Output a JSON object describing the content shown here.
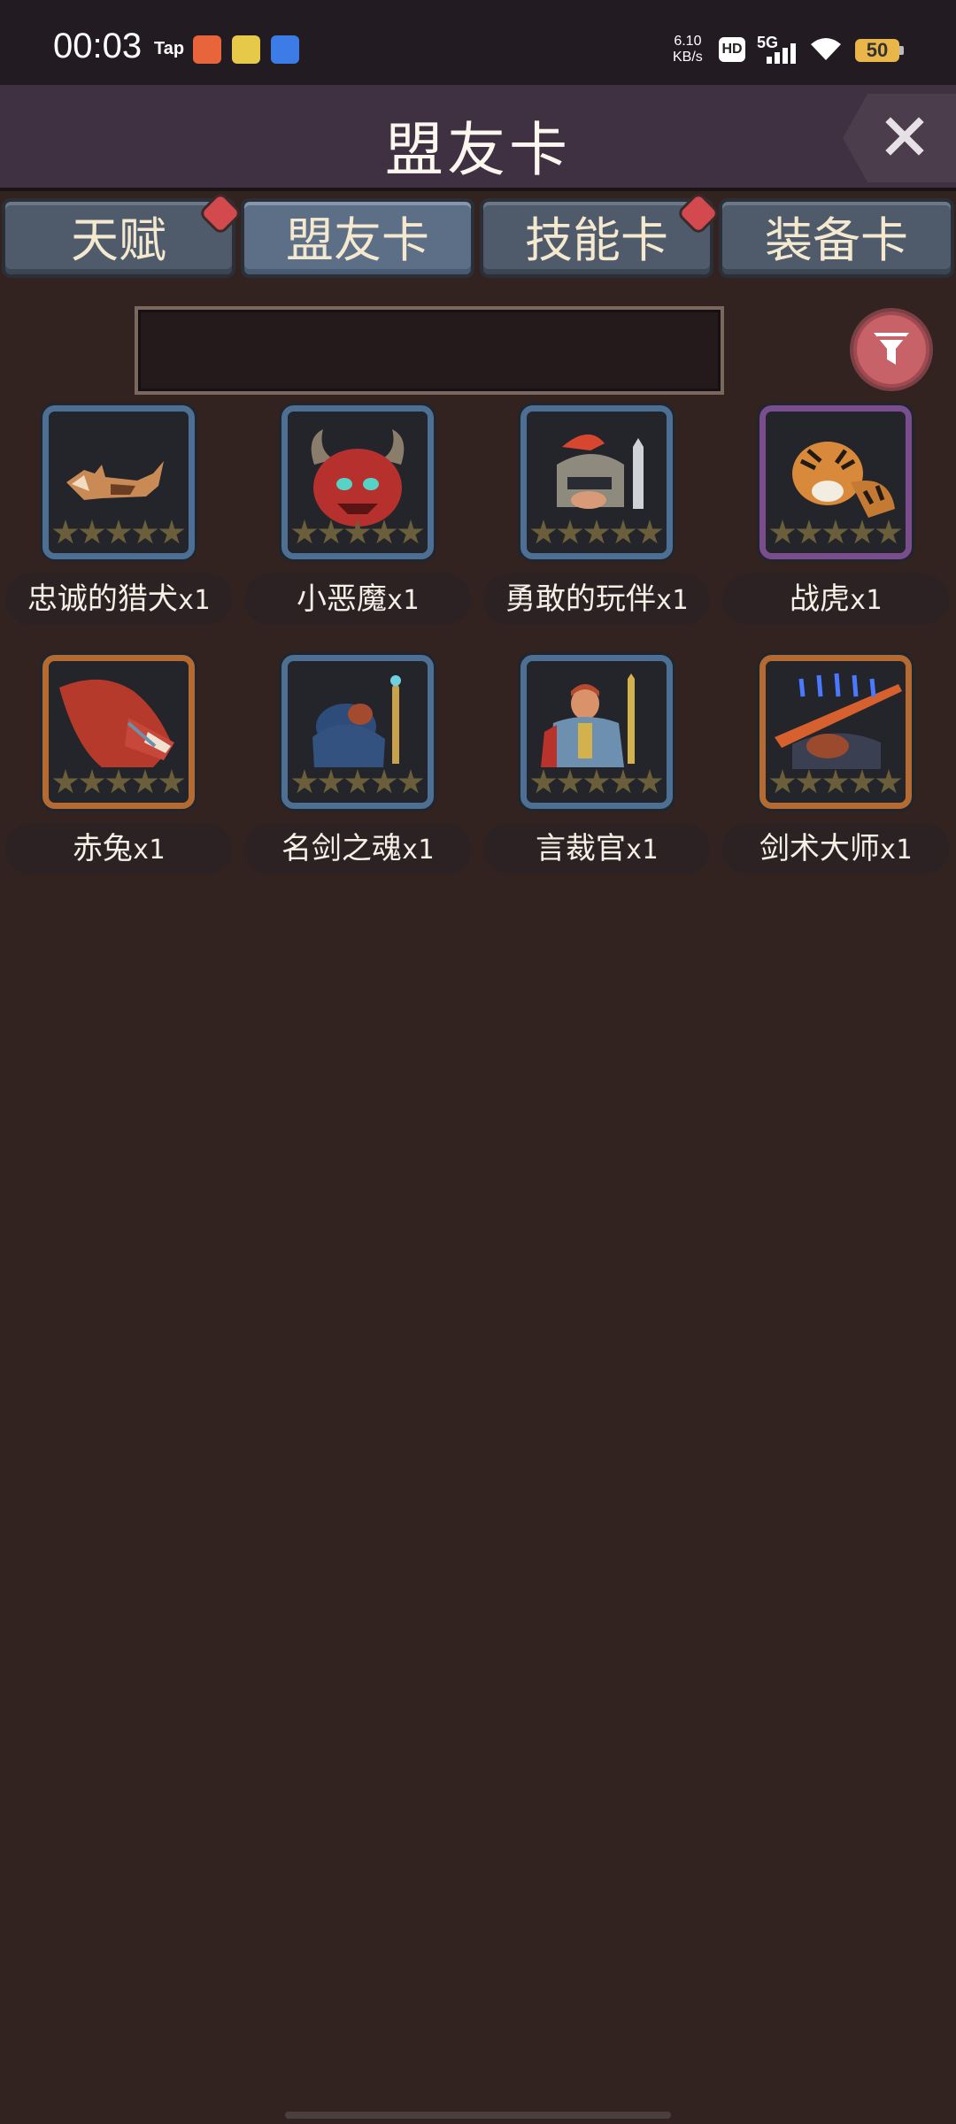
{
  "status_bar": {
    "time": "00:03",
    "tap_label": "Tap",
    "speed_value": "6.10",
    "speed_unit": "KB/s",
    "hd_label": "HD",
    "network_label": "5G",
    "battery_level": "50",
    "app_icon_colors": [
      "#e8643a",
      "#e7c94a",
      "#3d7be6"
    ]
  },
  "header": {
    "title": "盟友卡",
    "close_icon": "close-icon"
  },
  "tabs": [
    {
      "label": "天赋",
      "active": false,
      "has_badge": true
    },
    {
      "label": "盟友卡",
      "active": true,
      "has_badge": false
    },
    {
      "label": "技能卡",
      "active": false,
      "has_badge": true
    },
    {
      "label": "装备卡",
      "active": false,
      "has_badge": false
    }
  ],
  "search": {
    "value": "",
    "placeholder": ""
  },
  "filter_icon": "funnel-icon",
  "cards": [
    {
      "name": "忠诚的猎犬",
      "qty": "x1",
      "frame": "blue",
      "portrait_icon": "hound-portrait",
      "stars_filled": 0
    },
    {
      "name": "小恶魔",
      "qty": "x1",
      "frame": "blue",
      "portrait_icon": "imp-portrait",
      "stars_filled": 0
    },
    {
      "name": "勇敢的玩伴",
      "qty": "x1",
      "frame": "blue",
      "portrait_icon": "knight-portrait",
      "stars_filled": 0
    },
    {
      "name": "战虎",
      "qty": "x1",
      "frame": "purple",
      "portrait_icon": "tiger-portrait",
      "stars_filled": 0
    },
    {
      "name": "赤兔",
      "qty": "x1",
      "frame": "orange",
      "portrait_icon": "horse-portrait",
      "stars_filled": 0
    },
    {
      "name": "名剑之魂",
      "qty": "x1",
      "frame": "blue",
      "portrait_icon": "sword-spirit-portrait",
      "stars_filled": 0
    },
    {
      "name": "言裁官",
      "qty": "x1",
      "frame": "blue",
      "portrait_icon": "judge-portrait",
      "stars_filled": 0
    },
    {
      "name": "剑术大师",
      "qty": "x1",
      "frame": "orange",
      "portrait_icon": "swordmaster-portrait",
      "stars_filled": 0
    }
  ]
}
